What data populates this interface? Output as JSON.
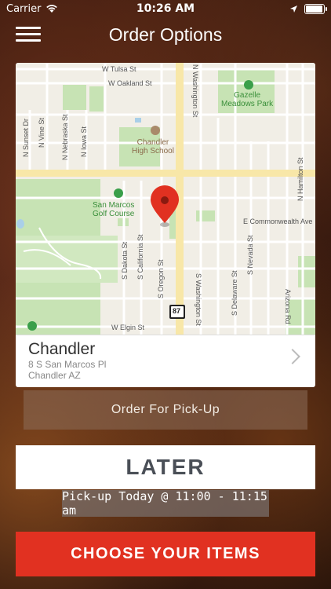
{
  "status_bar": {
    "carrier": "Carrier",
    "time": "10:26 AM",
    "battery_level": 0.95
  },
  "header": {
    "title": "Order Options",
    "menu_icon": "hamburger-menu-icon"
  },
  "map": {
    "labels": {
      "tulsa": "W Tulsa St",
      "oakland": "W Oakland St",
      "washington_n": "N Washington St",
      "gazelle": "Gazelle\nMeadows Park",
      "chandler_hs": "Chandler\nHigh School",
      "sunset": "N Sunset Dr",
      "vine": "N Vine St",
      "nebraska": "N Nebraska St",
      "iowa": "N Iowa St",
      "hamilton": "N Hamilton St",
      "san_marcos": "San Marcos\nGolf Course",
      "commonwealth": "E Commonwealth Ave",
      "dakota": "S Dakota St",
      "california": "S California St",
      "oregon": "S Oregon St",
      "washington_s": "S Washington St",
      "delaware": "S Delaware St",
      "nevada": "S Nevada St",
      "hwy": "87",
      "elgin": "W Elgin St",
      "arizona": "Arizona Rd"
    },
    "pin_color": "#e13121"
  },
  "location": {
    "name": "Chandler",
    "address": "8 S San Marcos Pl",
    "city": "Chandler AZ"
  },
  "buttons": {
    "pickup": "Order For Pick-Up",
    "later": "LATER",
    "pickup_time": "Pick-up Today @ 11:00 - 11:15 am",
    "choose": "CHOOSE YOUR ITEMS"
  },
  "colors": {
    "accent": "#e13121",
    "later_text": "#4a4f57"
  }
}
